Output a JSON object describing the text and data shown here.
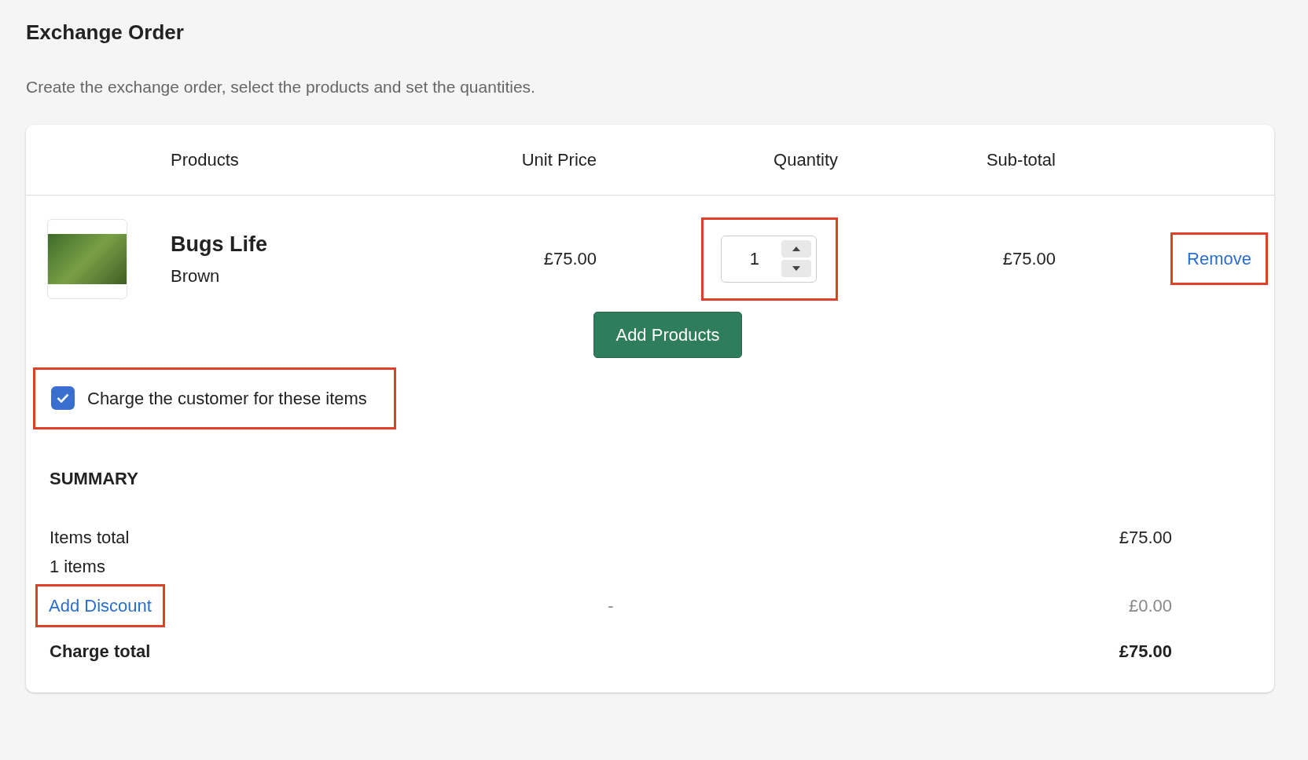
{
  "title": "Exchange Order",
  "description": "Create the exchange order, select the products and set the quantities.",
  "table": {
    "columns": [
      "Products",
      "Unit Price",
      "Quantity",
      "Sub-total"
    ],
    "rows": [
      {
        "name": "Bugs Life",
        "variant": "Brown",
        "unit_price": "£75.00",
        "quantity": "1",
        "quantity_highlighted": true,
        "subtotal": "£75.00",
        "remove": "Remove",
        "remove_highlighted": true
      }
    ]
  },
  "add_products": "Add Products",
  "charge_checkbox": {
    "label": "Charge the customer for these items",
    "checked": true,
    "highlighted": true
  },
  "summary": {
    "heading": "SUMMARY",
    "items_total": {
      "label": "Items total",
      "count": "1 items",
      "value": "£75.00"
    },
    "discount": {
      "label": "Add Discount",
      "highlighted": true,
      "dash": "-",
      "value": "£0.00"
    },
    "charge_total": {
      "label": "Charge total",
      "value": "£75.00"
    }
  }
}
